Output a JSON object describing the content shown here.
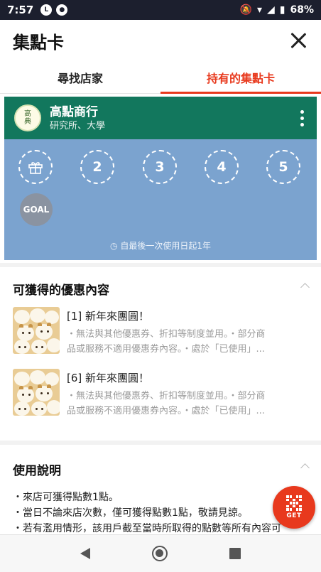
{
  "status_bar": {
    "time": "7:57",
    "battery": "68%"
  },
  "header": {
    "title": "集點卡"
  },
  "tabs": [
    {
      "label": "尋找店家"
    },
    {
      "label": "持有的集點卡"
    }
  ],
  "card": {
    "logo_text": [
      "高",
      "典"
    ],
    "shop_name": "高點商行",
    "shop_sub": "研究所、大學",
    "stamps": [
      "2",
      "3",
      "4",
      "5"
    ],
    "goal_label": "GOAL",
    "validity": "自最後一次使用日起1年",
    "colors": {
      "header": "#12775d",
      "body": "#7ba3cf"
    }
  },
  "benefits": {
    "title": "可獲得的優惠內容",
    "items": [
      {
        "title": "[1] 新年來團圓！",
        "desc_line1": "・無法與其他優惠券、折扣等制度並用。・部分商",
        "desc_line2": "品或服務不適用優惠券內容。・處於「已使用」..."
      },
      {
        "title": "[6] 新年來團圓！",
        "desc_line1": "・無法與其他優惠券、折扣等制度並用。・部分商",
        "desc_line2": "品或服務不適用優惠券內容。・處於「已使用」..."
      }
    ]
  },
  "instructions": {
    "title": "使用說明",
    "lines": [
      "・來店可獲得點數1點。",
      "・當日不論來店次數，僅可獲得點數1點，敬請見諒。",
      "・若有濫用情形，該用戶截至當時所取得的點數等所有內容可"
    ]
  },
  "fab": {
    "label": "GET"
  },
  "accent_color": "#e8391d"
}
